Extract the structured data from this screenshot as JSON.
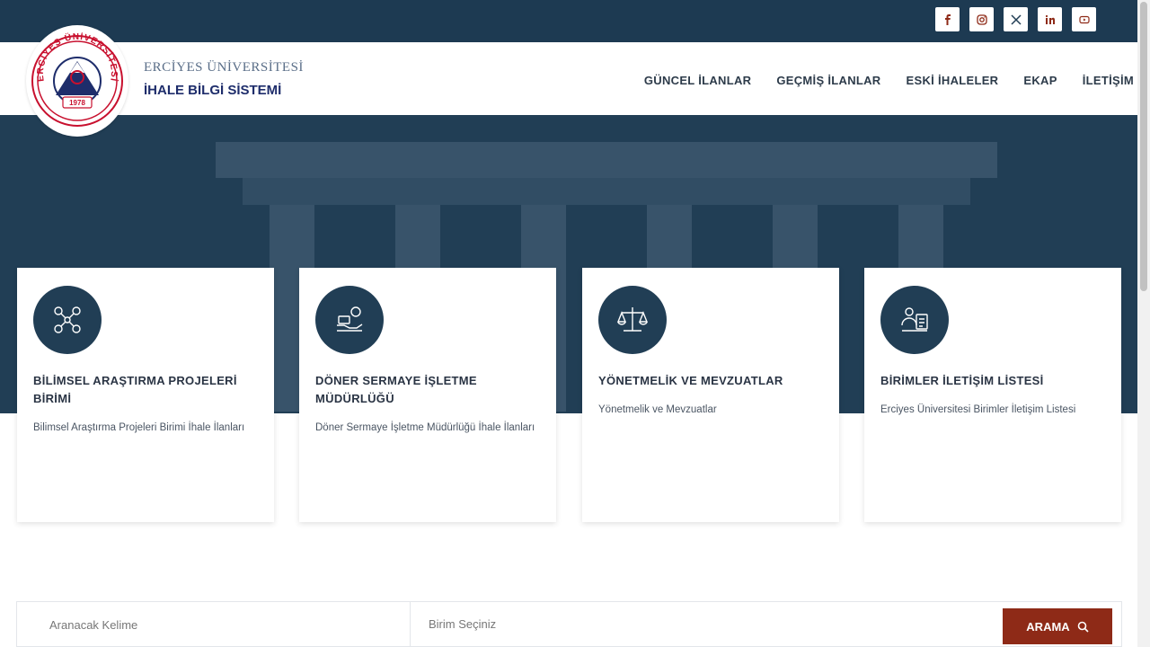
{
  "social": [
    {
      "icon": "facebook-icon",
      "glyph": "f"
    },
    {
      "icon": "instagram-icon",
      "glyph": ""
    },
    {
      "icon": "x-icon",
      "glyph": "X"
    },
    {
      "icon": "linkedin-icon",
      "glyph": "in"
    },
    {
      "icon": "youtube-icon",
      "glyph": ""
    }
  ],
  "brand": {
    "line1": "ERCİYES ÜNİVERSİTESİ",
    "line2": "İHALE BİLGİ SİSTEMİ",
    "seal_text": "ERCİYES ÜNİVERSİTESİ",
    "seal_year": "1978"
  },
  "nav": [
    "GÜNCEL İLANLAR",
    "GEÇMİŞ İLANLAR",
    "ESKİ İHALELER",
    "EKAP",
    "İLETİŞİM"
  ],
  "cards": [
    {
      "title": "BİLİMSEL ARAŞTIRMA PROJELERİ BİRİMİ",
      "desc": "Bilimsel Araştırma Projeleri Birimi İhale İlanları",
      "icon": "research-network-icon"
    },
    {
      "title": "DÖNER SERMAYE İŞLETME MÜDÜRLÜĞÜ",
      "desc": "Döner Sermaye İşletme Müdürlüğü İhale İlanları",
      "icon": "hand-coins-icon"
    },
    {
      "title": "YÖNETMELİK VE MEVZUATLAR",
      "desc": "Yönetmelik ve Mevzuatlar",
      "icon": "scales-icon"
    },
    {
      "title": "BİRİMLER İLETİŞİM LİSTESİ",
      "desc": "Erciyes Üniversitesi Birimler İletişim Listesi",
      "icon": "contact-list-icon"
    }
  ],
  "search": {
    "keyword_placeholder": "Aranacak Kelime",
    "unit_placeholder": "Birim Seçiniz",
    "button_label": "ARAMA"
  },
  "colors": {
    "navy": "#213e55",
    "brand_blue": "#1e2d6b",
    "button_red": "#8e2a17"
  }
}
